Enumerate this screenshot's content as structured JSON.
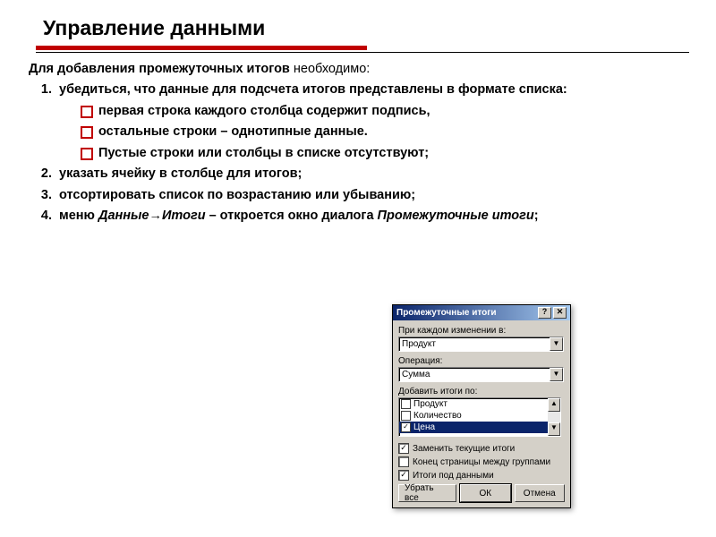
{
  "title": "Управление данными",
  "intro_bold": "Для добавления промежуточных итогов",
  "intro_rest": " необходимо:",
  "steps": [
    "убедиться, что данные для подсчета итогов представлены в формате списка:",
    "указать ячейку в столбце для итогов;",
    "отсортировать список по возрастанию или убыванию;"
  ],
  "step4_prefix": "меню ",
  "step4_menu": "Данные",
  "step4_arrow": "→",
  "step4_menu2": "Итоги",
  "step4_mid": " – откроется окно диалога ",
  "step4_dlg": "Промежуточные итоги",
  "step4_end": ";",
  "sublist": [
    "первая строка каждого столбца содержит подпись,",
    "остальные строки – однотипные данные.",
    "Пустые строки или столбцы в списке отсутствуют;"
  ],
  "dialog": {
    "title": "Промежуточные итоги",
    "help_btn": "?",
    "close_btn": "✕",
    "lbl_change": "При каждом изменении в:",
    "change_value": "Продукт",
    "lbl_op": "Операция:",
    "op_value": "Сумма",
    "lbl_add": "Добавить итоги по:",
    "items": [
      {
        "label": "Продукт",
        "checked": false,
        "selected": false
      },
      {
        "label": "Количество",
        "checked": false,
        "selected": false
      },
      {
        "label": "Цена",
        "checked": true,
        "selected": true
      }
    ],
    "chk_replace": "Заменить текущие итоги",
    "chk_replace_on": true,
    "chk_page": "Конец страницы между группами",
    "chk_page_on": false,
    "chk_under": "Итоги под данными",
    "chk_under_on": true,
    "btn_clear": "Убрать все",
    "btn_ok": "ОК",
    "btn_cancel": "Отмена"
  }
}
